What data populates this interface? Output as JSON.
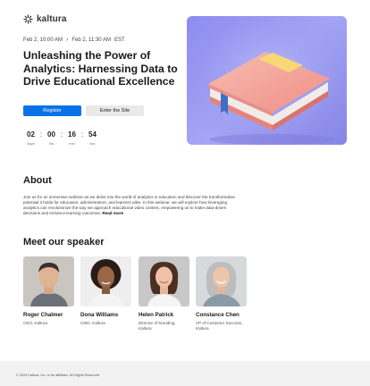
{
  "brand": {
    "name": "kaltura"
  },
  "event": {
    "start": "Feb 2, 10:00 AM",
    "end": "Feb 2, 11:30 AM",
    "timezone": "EST",
    "title": "Unleashing the Power of Analytics: Harnessing Data to Drive Educational Excellence"
  },
  "buttons": {
    "register": "Register",
    "enter": "Enter the Site"
  },
  "countdown": [
    {
      "value": "02",
      "label": "days"
    },
    {
      "value": "00",
      "label": "hrs"
    },
    {
      "value": "16",
      "label": "min"
    },
    {
      "value": "54",
      "label": "sec"
    }
  ],
  "countdown_separator": ":",
  "about": {
    "heading": "About",
    "body": "Join us for an immersive webinar as we delve into the world of analytics in education and discover the transformative potential it holds for educators, administrators, and learners alike. In this webinar, we will explore how leveraging analytics can revolutionize the way we approach educational video content, empowering us to make data-driven decisions and enhance learning outcomes.",
    "read_more": "Read more"
  },
  "speakers": {
    "heading": "Meet our speaker",
    "items": [
      {
        "name": "Roger Chalmer",
        "role": "CEO, Kaltura"
      },
      {
        "name": "Dona Williams",
        "role": "CMO, Kaltura"
      },
      {
        "name": "Helen Patrick",
        "role": "Director of branding, Kaltura"
      },
      {
        "name": "Constance Chen",
        "role": "VP of Customer Success, Kaltura"
      }
    ]
  },
  "footer": {
    "text": "© 2023 Kaltura, Inc. or its affiliates. All Rights Reserved"
  },
  "colors": {
    "primary": "#0a72e8",
    "hero_bg": "#9a9af2",
    "book": "#f4a99f",
    "bookmark": "#3e6fc7"
  }
}
